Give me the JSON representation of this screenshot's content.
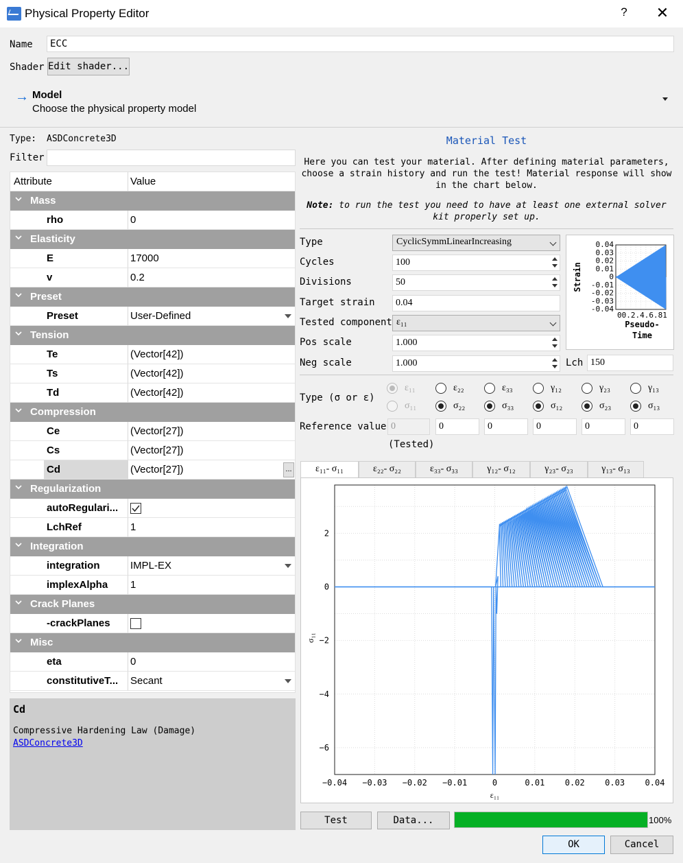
{
  "window": {
    "title": "Physical Property Editor",
    "help": "?",
    "close": "✕"
  },
  "name_field": {
    "label": "Name",
    "value": "ECC"
  },
  "shader": {
    "label": "Shader",
    "button": "Edit shader..."
  },
  "model": {
    "title": "Model",
    "subtitle": "Choose the physical property model"
  },
  "type": {
    "label": "Type:",
    "value": "ASDConcrete3D"
  },
  "filter": {
    "label": "Filter",
    "value": ""
  },
  "table": {
    "headers": [
      "Attribute",
      "Value"
    ],
    "groups": {
      "mass": "Mass",
      "elasticity": "Elasticity",
      "preset": "Preset",
      "tension": "Tension",
      "compression": "Compression",
      "regularization": "Regularization",
      "integration": "Integration",
      "crack_planes": "Crack Planes",
      "misc": "Misc"
    },
    "rows": {
      "rho": {
        "name": "rho",
        "value": "0"
      },
      "E": {
        "name": "E",
        "value": "17000"
      },
      "v": {
        "name": "v",
        "value": "0.2"
      },
      "preset": {
        "name": "Preset",
        "value": "User-Defined"
      },
      "Te": {
        "name": "Te",
        "value": "(Vector[42])"
      },
      "Ts": {
        "name": "Ts",
        "value": "(Vector[42])"
      },
      "Td": {
        "name": "Td",
        "value": "(Vector[42])"
      },
      "Ce": {
        "name": "Ce",
        "value": "(Vector[27])"
      },
      "Cs": {
        "name": "Cs",
        "value": "(Vector[27])"
      },
      "Cd": {
        "name": "Cd",
        "value": "(Vector[27])",
        "button": "..."
      },
      "autoReg": {
        "name": "autoRegulari...",
        "checked": true
      },
      "LchRef": {
        "name": "LchRef",
        "value": "1"
      },
      "integration": {
        "name": "integration",
        "value": "IMPL-EX"
      },
      "implexAlpha": {
        "name": "implexAlpha",
        "value": "1"
      },
      "crackPlanes": {
        "name": "-crackPlanes",
        "checked": false
      },
      "eta": {
        "name": "eta",
        "value": "0"
      },
      "constitutive": {
        "name": "constitutiveT...",
        "value": "Secant"
      }
    }
  },
  "description": {
    "title": "Cd",
    "text": "Compressive Hardening Law (Damage)",
    "link": "ASDConcrete3D"
  },
  "material_test": {
    "title": "Material Test",
    "intro": "Here you can test your material. After defining material parameters, choose a strain history and run the test! Material response will show in the chart below.",
    "note_label": "Note:",
    "note": " to run the test you need to have at least one external solver kit properly set up.",
    "type_label": "Type",
    "type_value": "CyclicSymmLinearIncreasing",
    "cycles_label": "Cycles",
    "cycles_value": "100",
    "divisions_label": "Divisions",
    "divisions_value": "50",
    "target_label": "Target strain",
    "target_value": "0.04",
    "component_label": "Tested component",
    "component_value": "ε₁₁",
    "pos_label": "Pos scale",
    "pos_value": "1.000",
    "neg_label": "Neg scale",
    "neg_value": "1.000",
    "lch_label": "Lch",
    "lch_value": "150",
    "sigeps_label": "Type (σ or ε)",
    "eps_labels": [
      "ε₁₁",
      "ε₂₂",
      "ε₃₃",
      "γ₁₂",
      "γ₂₃",
      "γ₁₃"
    ],
    "sig_labels": [
      "σ₁₁",
      "σ₂₂",
      "σ₃₃",
      "σ₁₂",
      "σ₂₃",
      "σ₁₃"
    ],
    "ref_label": "Reference value",
    "ref_values": [
      "0",
      "0",
      "0",
      "0",
      "0",
      "0"
    ],
    "tested_label": "(Tested)",
    "tabs": [
      "ε₁₁- σ₁₁",
      "ε₂₂- σ₂₂",
      "ε₃₃- σ₃₃",
      "γ₁₂- σ₁₂",
      "γ₂₃- σ₂₃",
      "γ₁₃- σ₁₃"
    ],
    "test_btn": "Test",
    "data_btn": "Data...",
    "progress": 100,
    "progress_text": "100%"
  },
  "buttons": {
    "ok": "OK",
    "cancel": "Cancel"
  },
  "colors": {
    "series": "#3f8ff0",
    "group": "#a0a0a0",
    "progress": "#06b025",
    "link": "#0000ee",
    "title_blue": "#1a56b8"
  },
  "chart_data": [
    {
      "type": "line",
      "title": "",
      "xlabel": "Pseudo-Time",
      "ylabel": "Strain",
      "xlim": [
        0,
        1
      ],
      "ylim": [
        -0.04,
        0.04
      ],
      "yticks": [
        "0.04",
        "0.03",
        "0.02",
        "0.01",
        "0",
        "-0.01",
        "-0.02",
        "-0.03",
        "-0.04"
      ],
      "xticks": [
        "00.2.4.6.81"
      ],
      "series": [
        {
          "description": "cyclic symmetric linearly increasing strain",
          "x": [
            0,
            1
          ],
          "amplitude": [
            0,
            0.04
          ],
          "cycles": 100
        }
      ]
    },
    {
      "type": "line",
      "xlabel": "ε₁₁",
      "ylabel": "σ₁₁",
      "xlim": [
        -0.04,
        0.04
      ],
      "ylim": [
        -7,
        3.8
      ],
      "xticks": [
        "−0.04",
        "−0.03",
        "−0.02",
        "−0.01",
        "0",
        "0.01",
        "0.02",
        "0.03",
        "0.04"
      ],
      "yticks": [
        "2",
        "0",
        "−2",
        "−4",
        "−6"
      ],
      "grid": true,
      "series": [
        {
          "description": "stress-strain response",
          "x": [
            -0.04,
            -0.0008,
            -0.0004,
            0,
            0.0003,
            0.0005,
            0.001,
            0.018,
            0.027,
            0.04
          ],
          "y": [
            0,
            0,
            -7,
            0,
            -7,
            0,
            2.4,
            3.7,
            0,
            0
          ]
        }
      ]
    }
  ]
}
